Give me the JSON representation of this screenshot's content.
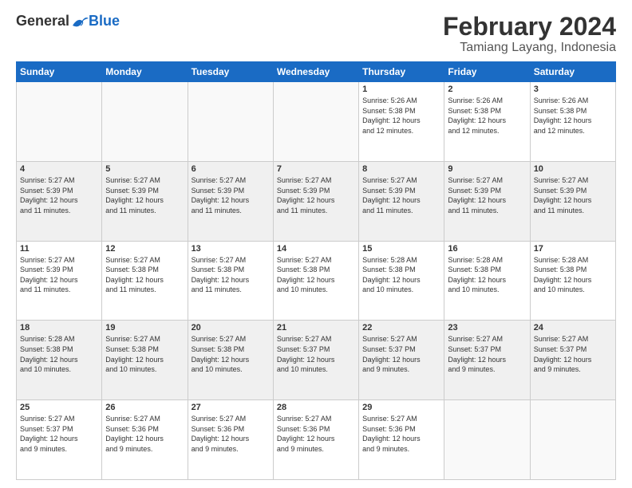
{
  "header": {
    "logo_general": "General",
    "logo_blue": "Blue",
    "month_year": "February 2024",
    "location": "Tamiang Layang, Indonesia"
  },
  "days_of_week": [
    "Sunday",
    "Monday",
    "Tuesday",
    "Wednesday",
    "Thursday",
    "Friday",
    "Saturday"
  ],
  "weeks": [
    [
      {
        "day": "",
        "info": ""
      },
      {
        "day": "",
        "info": ""
      },
      {
        "day": "",
        "info": ""
      },
      {
        "day": "",
        "info": ""
      },
      {
        "day": "1",
        "info": "Sunrise: 5:26 AM\nSunset: 5:38 PM\nDaylight: 12 hours\nand 12 minutes."
      },
      {
        "day": "2",
        "info": "Sunrise: 5:26 AM\nSunset: 5:38 PM\nDaylight: 12 hours\nand 12 minutes."
      },
      {
        "day": "3",
        "info": "Sunrise: 5:26 AM\nSunset: 5:38 PM\nDaylight: 12 hours\nand 12 minutes."
      }
    ],
    [
      {
        "day": "4",
        "info": "Sunrise: 5:27 AM\nSunset: 5:39 PM\nDaylight: 12 hours\nand 11 minutes."
      },
      {
        "day": "5",
        "info": "Sunrise: 5:27 AM\nSunset: 5:39 PM\nDaylight: 12 hours\nand 11 minutes."
      },
      {
        "day": "6",
        "info": "Sunrise: 5:27 AM\nSunset: 5:39 PM\nDaylight: 12 hours\nand 11 minutes."
      },
      {
        "day": "7",
        "info": "Sunrise: 5:27 AM\nSunset: 5:39 PM\nDaylight: 12 hours\nand 11 minutes."
      },
      {
        "day": "8",
        "info": "Sunrise: 5:27 AM\nSunset: 5:39 PM\nDaylight: 12 hours\nand 11 minutes."
      },
      {
        "day": "9",
        "info": "Sunrise: 5:27 AM\nSunset: 5:39 PM\nDaylight: 12 hours\nand 11 minutes."
      },
      {
        "day": "10",
        "info": "Sunrise: 5:27 AM\nSunset: 5:39 PM\nDaylight: 12 hours\nand 11 minutes."
      }
    ],
    [
      {
        "day": "11",
        "info": "Sunrise: 5:27 AM\nSunset: 5:39 PM\nDaylight: 12 hours\nand 11 minutes."
      },
      {
        "day": "12",
        "info": "Sunrise: 5:27 AM\nSunset: 5:38 PM\nDaylight: 12 hours\nand 11 minutes."
      },
      {
        "day": "13",
        "info": "Sunrise: 5:27 AM\nSunset: 5:38 PM\nDaylight: 12 hours\nand 11 minutes."
      },
      {
        "day": "14",
        "info": "Sunrise: 5:27 AM\nSunset: 5:38 PM\nDaylight: 12 hours\nand 10 minutes."
      },
      {
        "day": "15",
        "info": "Sunrise: 5:28 AM\nSunset: 5:38 PM\nDaylight: 12 hours\nand 10 minutes."
      },
      {
        "day": "16",
        "info": "Sunrise: 5:28 AM\nSunset: 5:38 PM\nDaylight: 12 hours\nand 10 minutes."
      },
      {
        "day": "17",
        "info": "Sunrise: 5:28 AM\nSunset: 5:38 PM\nDaylight: 12 hours\nand 10 minutes."
      }
    ],
    [
      {
        "day": "18",
        "info": "Sunrise: 5:28 AM\nSunset: 5:38 PM\nDaylight: 12 hours\nand 10 minutes."
      },
      {
        "day": "19",
        "info": "Sunrise: 5:27 AM\nSunset: 5:38 PM\nDaylight: 12 hours\nand 10 minutes."
      },
      {
        "day": "20",
        "info": "Sunrise: 5:27 AM\nSunset: 5:38 PM\nDaylight: 12 hours\nand 10 minutes."
      },
      {
        "day": "21",
        "info": "Sunrise: 5:27 AM\nSunset: 5:37 PM\nDaylight: 12 hours\nand 10 minutes."
      },
      {
        "day": "22",
        "info": "Sunrise: 5:27 AM\nSunset: 5:37 PM\nDaylight: 12 hours\nand 9 minutes."
      },
      {
        "day": "23",
        "info": "Sunrise: 5:27 AM\nSunset: 5:37 PM\nDaylight: 12 hours\nand 9 minutes."
      },
      {
        "day": "24",
        "info": "Sunrise: 5:27 AM\nSunset: 5:37 PM\nDaylight: 12 hours\nand 9 minutes."
      }
    ],
    [
      {
        "day": "25",
        "info": "Sunrise: 5:27 AM\nSunset: 5:37 PM\nDaylight: 12 hours\nand 9 minutes."
      },
      {
        "day": "26",
        "info": "Sunrise: 5:27 AM\nSunset: 5:36 PM\nDaylight: 12 hours\nand 9 minutes."
      },
      {
        "day": "27",
        "info": "Sunrise: 5:27 AM\nSunset: 5:36 PM\nDaylight: 12 hours\nand 9 minutes."
      },
      {
        "day": "28",
        "info": "Sunrise: 5:27 AM\nSunset: 5:36 PM\nDaylight: 12 hours\nand 9 minutes."
      },
      {
        "day": "29",
        "info": "Sunrise: 5:27 AM\nSunset: 5:36 PM\nDaylight: 12 hours\nand 9 minutes."
      },
      {
        "day": "",
        "info": ""
      },
      {
        "day": "",
        "info": ""
      }
    ]
  ]
}
